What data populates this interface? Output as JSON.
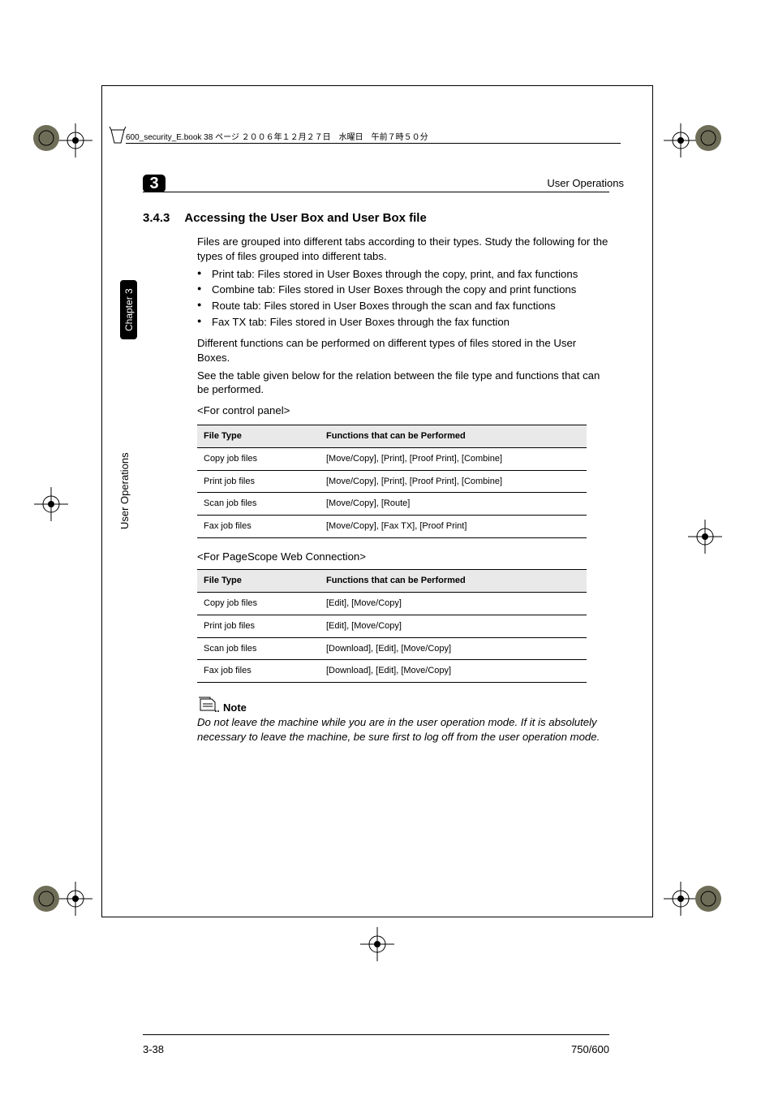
{
  "filebar": {
    "text": "600_security_E.book  38 ページ  ２００６年１２月２７日　水曜日　午前７時５０分"
  },
  "chapter_badge": "3",
  "header_right": "User Operations",
  "side_chapter": "Chapter 3",
  "side_label": "User Operations",
  "section": {
    "number": "3.4.3",
    "title": "Accessing the User Box and User Box file"
  },
  "intro": "Files are grouped into different tabs according to their types. Study the following for the types of files grouped into different tabs.",
  "bullets": [
    "Print tab: Files stored in User Boxes through the copy, print, and fax functions",
    "Combine tab: Files stored in User Boxes through the copy and print functions",
    "Route tab: Files stored in User Boxes through the scan and fax functions",
    "Fax TX tab: Files stored in User Boxes through the fax function"
  ],
  "para_functions": "Different functions can be performed on different types of files stored in the User Boxes.",
  "para_see_table": "See the table given below for the relation between the file type and functions that can be performed.",
  "label_control_panel": "<For control panel>",
  "label_pagescope": "<For PageScope Web Connection>",
  "table_header_col1": "File Type",
  "table_header_col2": "Functions that can be Performed",
  "table_control_panel": [
    {
      "type": "Copy job files",
      "fn": "[Move/Copy], [Print], [Proof Print], [Combine]"
    },
    {
      "type": "Print job files",
      "fn": "[Move/Copy], [Print], [Proof Print], [Combine]"
    },
    {
      "type": "Scan job files",
      "fn": "[Move/Copy], [Route]"
    },
    {
      "type": "Fax job files",
      "fn": "[Move/Copy], [Fax TX], [Proof Print]"
    }
  ],
  "table_pagescope": [
    {
      "type": "Copy job files",
      "fn": "[Edit], [Move/Copy]"
    },
    {
      "type": "Print job files",
      "fn": "[Edit], [Move/Copy]"
    },
    {
      "type": "Scan job files",
      "fn": "[Download], [Edit], [Move/Copy]"
    },
    {
      "type": "Fax job files",
      "fn": "[Download], [Edit], [Move/Copy]"
    }
  ],
  "note_heading": "Note",
  "note_text": "Do not leave the machine while you are in the user operation mode. If it is absolutely necessary to leave the machine, be sure first to log off from the user operation mode.",
  "footer": {
    "left": "3-38",
    "right": "750/600"
  }
}
